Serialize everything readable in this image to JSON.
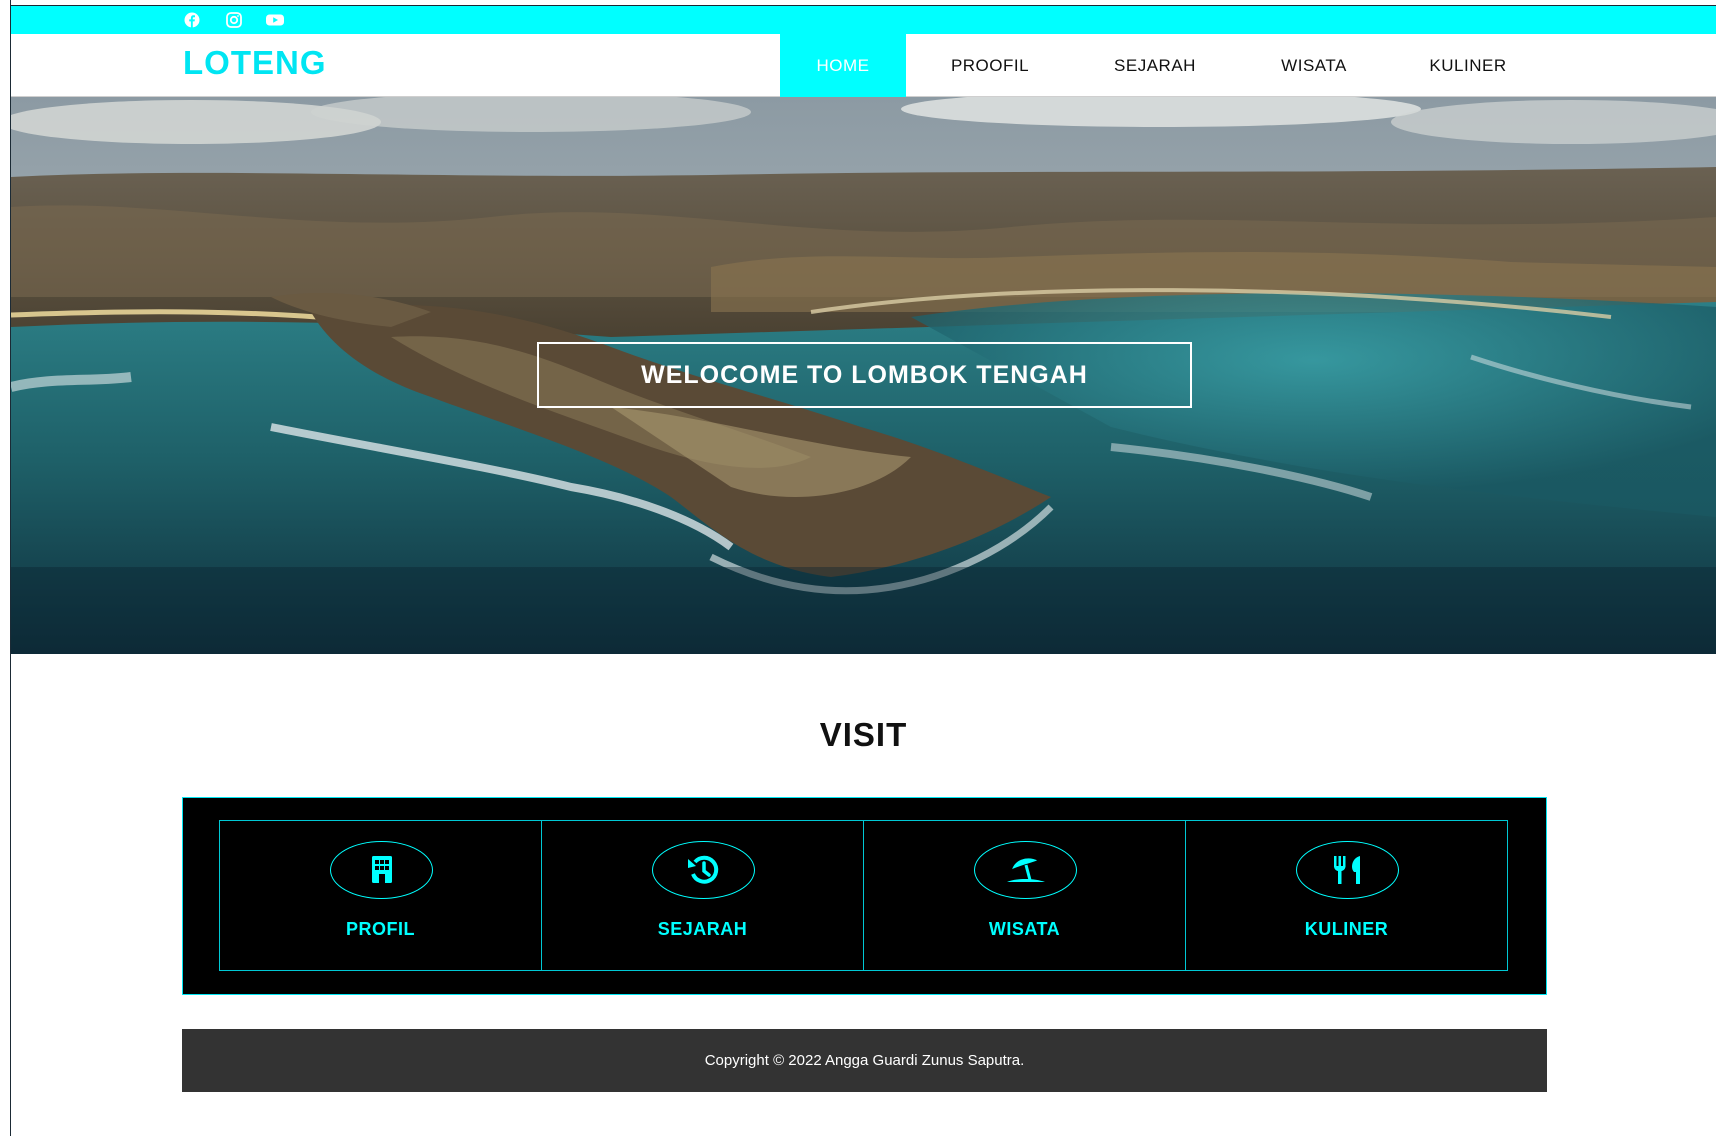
{
  "social": {
    "icons": [
      "facebook-icon",
      "instagram-icon",
      "youtube-icon"
    ]
  },
  "header": {
    "logo": "LOTENG",
    "nav": [
      "HOME",
      "PROOFIL",
      "SEJARAH",
      "WISATA",
      "KULINER"
    ],
    "active": "HOME"
  },
  "hero": {
    "heading": "WELOCOME TO LOMBOK TENGAH",
    "image": "aerial coastline landscape"
  },
  "visit": {
    "title": "VISIT",
    "cards": [
      {
        "label": "PROFIL",
        "icon": "building-icon"
      },
      {
        "label": "SEJARAH",
        "icon": "history-icon"
      },
      {
        "label": "WISATA",
        "icon": "beach-umbrella-icon"
      },
      {
        "label": "KULINER",
        "icon": "utensils-icon"
      }
    ]
  },
  "footer": {
    "copyright": "Copyright © 2022 Angga Guardi Zunus Saputra."
  },
  "colors": {
    "accent": "#00ffff",
    "logo": "#00e5f2",
    "panel": "#000000",
    "footer": "#333333"
  }
}
